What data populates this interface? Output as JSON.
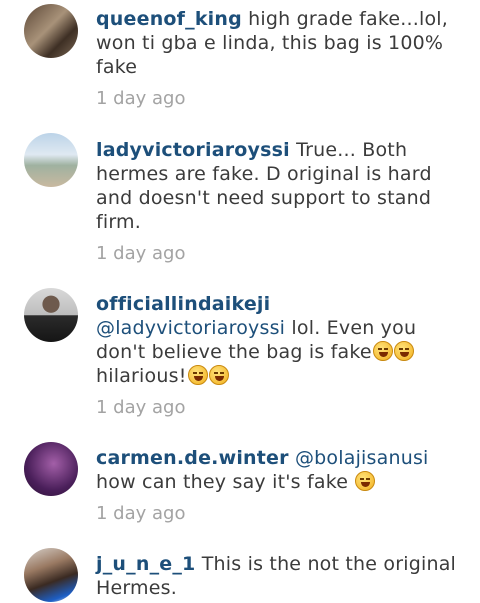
{
  "comments": [
    {
      "username": "queenof_king",
      "mention": "",
      "text": "high grade fake...lol, won ti gba e linda, this bag is 100% fake",
      "time": "1 day ago",
      "emojis": []
    },
    {
      "username": "ladyvictoriaroyssi",
      "mention": "",
      "text": "True... Both hermes are fake. D original is hard and doesn't need support to stand firm.",
      "time": "1 day ago",
      "emojis": []
    },
    {
      "username": "officiallindaikeji",
      "mention": "@ladyvictoriaroyssi",
      "text": "lol. Even you don't believe the bag is fake",
      "text2": "hilarious!",
      "time": "1 day ago",
      "emojis": [
        "grinning-face",
        "grinning-face",
        "grinning-face",
        "grinning-face"
      ]
    },
    {
      "username": "carmen.de.winter",
      "mention": "@bolajisanusi",
      "text": "how can they say it's fake",
      "time": "1 day ago",
      "emojis": [
        "laughing-face"
      ]
    },
    {
      "username": "j_u_n_e_1",
      "mention": "",
      "text": "This is the not the original Hermes.",
      "time": "",
      "emojis": []
    }
  ],
  "colors": {
    "username": "#1d4f7a",
    "text": "#3b3b3b",
    "timestamp": "#a3a3a3"
  }
}
